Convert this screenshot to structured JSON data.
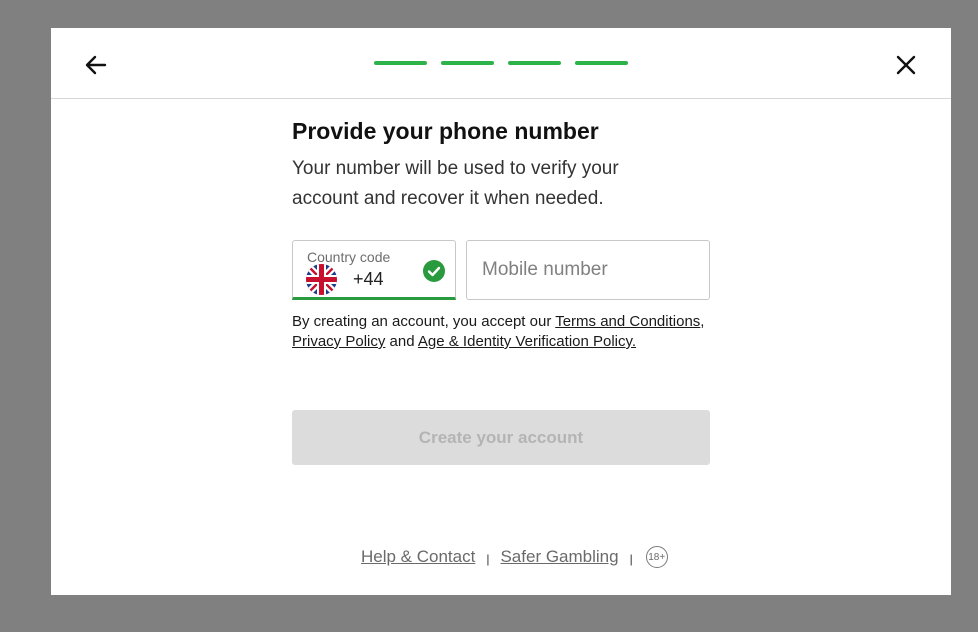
{
  "header": {
    "steps": [
      {
        "state": "complete"
      },
      {
        "state": "complete"
      },
      {
        "state": "complete"
      },
      {
        "state": "complete"
      }
    ],
    "step_color": "#2eb24a",
    "back_icon": "arrow-left-icon",
    "close_icon": "close-icon"
  },
  "form": {
    "title": "Provide your phone number",
    "subtitle": "Your number will be used to verify your account and recover it when needed.",
    "country": {
      "label": "Country code",
      "flag_icon": "uk-flag-icon",
      "value": "+44",
      "valid_icon": "check-circle-icon",
      "valid_color": "#2a9a3e"
    },
    "mobile": {
      "placeholder": "Mobile number",
      "value": ""
    },
    "terms": {
      "prefix": "By creating an account, you accept our ",
      "terms_link": "Terms and Conditions",
      "comma": ", ",
      "privacy_link": "Privacy Policy",
      "and": " and ",
      "age_link": "Age & Identity Verification Policy."
    },
    "submit_label": "Create your account"
  },
  "footer": {
    "help_link": "Help & Contact",
    "separator": "|",
    "safer_link": "Safer Gambling",
    "age_badge": "18+"
  }
}
